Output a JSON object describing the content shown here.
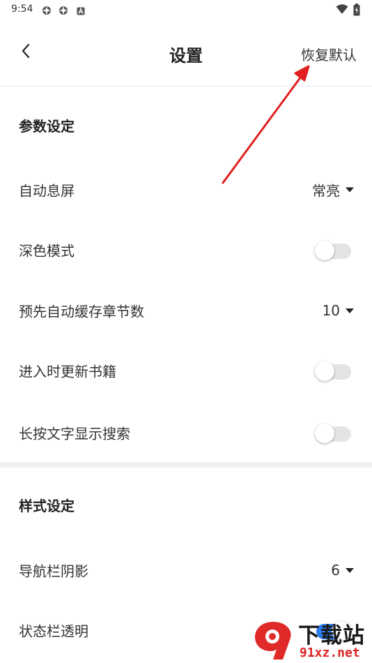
{
  "status_bar": {
    "time": "9:54",
    "icons": [
      "app-notification-icon",
      "app-notification-icon",
      "a-badge-icon"
    ],
    "right_icons": [
      "wifi-icon",
      "battery-charging-icon"
    ]
  },
  "header": {
    "back_icon": "chevron-left-icon",
    "title": "设置",
    "reset_label": "恢复默认"
  },
  "sections": [
    {
      "title": "参数设定",
      "items": [
        {
          "label": "自动息屏",
          "type": "dropdown",
          "value": "常亮"
        },
        {
          "label": "深色模式",
          "type": "switch",
          "on": false
        },
        {
          "label": "预先自动缓存章节数",
          "type": "dropdown",
          "value": "10"
        },
        {
          "label": "进入时更新书籍",
          "type": "switch",
          "on": false
        },
        {
          "label": "长按文字显示搜索",
          "type": "switch",
          "on": false
        }
      ]
    },
    {
      "title": "样式设定",
      "items": [
        {
          "label": "导航栏阴影",
          "type": "dropdown",
          "value": "6"
        },
        {
          "label": "状态栏透明",
          "type": "switch",
          "on": true
        }
      ]
    }
  ],
  "annotation": {
    "arrow_color": "#e02020"
  },
  "watermark": {
    "brand": "下载站",
    "site": "91xz.net"
  },
  "colors": {
    "accent": "#2c7ef0",
    "switch_off": "#e4e4e4",
    "text": "#333333"
  }
}
